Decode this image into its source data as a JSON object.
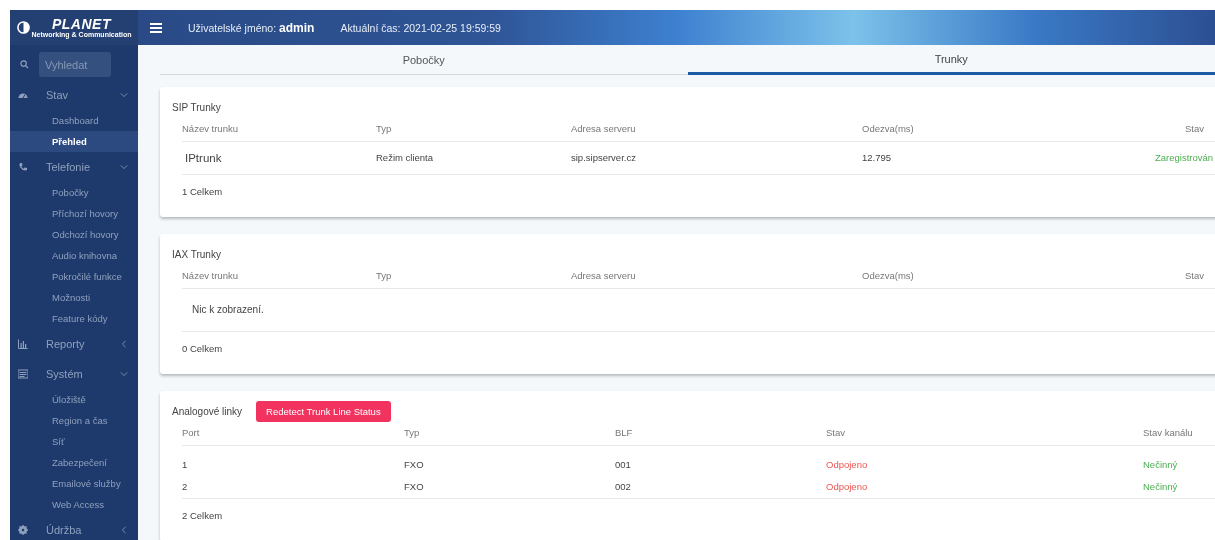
{
  "logo": {
    "name": "PLANET",
    "tagline": "Networking & Communication"
  },
  "header": {
    "user_label": "Uživatelské jméno:",
    "user": "admin",
    "time_label": "Aktuální čas:",
    "time": "2021-02-25 19:59:59"
  },
  "sidebar": {
    "search": {
      "placeholder": "Vyhledat"
    },
    "items": [
      {
        "label": "Stav",
        "expanded": true,
        "children": [
          {
            "label": "Dashboard",
            "selected": false
          },
          {
            "label": "Přehled",
            "selected": true
          }
        ]
      },
      {
        "label": "Telefonie",
        "expanded": true,
        "children": [
          {
            "label": "Pobočky",
            "selected": false
          },
          {
            "label": "Příchozí hovory",
            "selected": false
          },
          {
            "label": "Odchozí hovory",
            "selected": false
          },
          {
            "label": "Audio knihovna",
            "selected": false
          },
          {
            "label": "Pokročilé funkce",
            "selected": false
          },
          {
            "label": "Možnosti",
            "selected": false
          },
          {
            "label": "Feature kódy",
            "selected": false
          }
        ]
      },
      {
        "label": "Reporty",
        "expanded": false
      },
      {
        "label": "Systém",
        "expanded": true,
        "children": [
          {
            "label": "Úložiště",
            "selected": false
          },
          {
            "label": "Region a čas",
            "selected": false
          },
          {
            "label": "Síť",
            "selected": false
          },
          {
            "label": "Zabezpečení",
            "selected": false
          },
          {
            "label": "Emailové služby",
            "selected": false
          },
          {
            "label": "Web Access",
            "selected": false
          }
        ]
      },
      {
        "label": "Údržba",
        "expanded": false
      }
    ]
  },
  "tabs": [
    {
      "label": "Pobočky",
      "selected": false
    },
    {
      "label": "Trunky",
      "selected": true
    }
  ],
  "cards": [
    {
      "kind": "sip",
      "title": "SIP Trunky",
      "columns": [
        "Název trunku",
        "Typ",
        "Adresa serveru",
        "Odezva(ms)",
        "Stav"
      ],
      "rows": [
        [
          {
            "text": "IPtrunk"
          },
          {
            "text": "Režim clienta"
          },
          {
            "text": "sip.sipserver.cz"
          },
          {
            "text": "12.795"
          },
          {
            "text": "Zaregistrován",
            "kind": "success"
          }
        ]
      ],
      "footer": "1 Celkem"
    },
    {
      "kind": "sip",
      "title": "IAX Trunky",
      "columns": [
        "Název trunku",
        "Typ",
        "Adresa serveru",
        "Odezva(ms)",
        "Stav"
      ],
      "empty_text": "Nic k zobrazení.",
      "footer": "0 Celkem"
    },
    {
      "kind": "analog",
      "title": "Analogové linky",
      "button": "Redetect Trunk Line Status",
      "columns": [
        "Port",
        "Typ",
        "BLF",
        "Stav",
        "Stav kanálu"
      ],
      "rows": [
        [
          {
            "text": "1"
          },
          {
            "text": "FXO"
          },
          {
            "text": "001"
          },
          {
            "text": "Odpojeno",
            "kind": "danger"
          },
          {
            "text": "Nečinný",
            "kind": "success"
          }
        ],
        [
          {
            "text": "2"
          },
          {
            "text": "FXO"
          },
          {
            "text": "002"
          },
          {
            "text": "Odpojeno",
            "kind": "danger"
          },
          {
            "text": "Nečinný",
            "kind": "success"
          }
        ]
      ],
      "footer": "2 Celkem"
    }
  ]
}
